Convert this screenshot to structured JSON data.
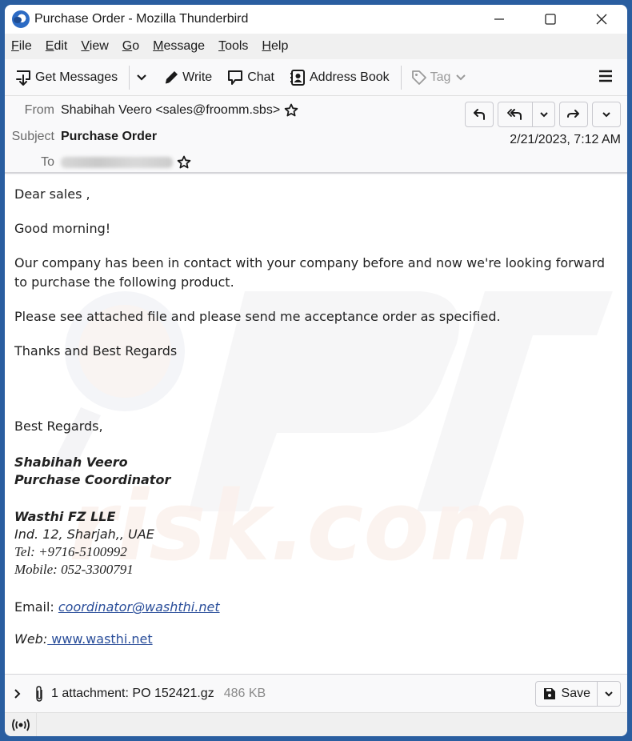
{
  "window": {
    "title": "Purchase Order - Mozilla Thunderbird",
    "controls": {
      "minimize": "minimize-icon",
      "maximize": "maximize-icon",
      "close": "close-icon"
    }
  },
  "menubar": {
    "items": [
      {
        "label": "File",
        "accel": "F",
        "rest": "ile"
      },
      {
        "label": "Edit",
        "accel": "E",
        "rest": "dit"
      },
      {
        "label": "View",
        "accel": "V",
        "rest": "iew"
      },
      {
        "label": "Go",
        "accel": "G",
        "rest": "o"
      },
      {
        "label": "Message",
        "accel": "M",
        "rest": "essage"
      },
      {
        "label": "Tools",
        "accel": "T",
        "rest": "ools"
      },
      {
        "label": "Help",
        "accel": "H",
        "rest": "elp"
      }
    ]
  },
  "toolbar": {
    "get_messages": "Get Messages",
    "write": "Write",
    "chat": "Chat",
    "address_book": "Address Book",
    "tag": "Tag"
  },
  "header": {
    "from_label": "From",
    "from_value": "Shabihah Veero <sales@froomm.sbs>",
    "subject_label": "Subject",
    "subject_value": "Purchase Order",
    "to_label": "To",
    "date": "2/21/2023, 7:12 AM"
  },
  "message": {
    "greeting": "Dear sales ,",
    "line1": "Good morning!",
    "line2": "Our company has been in contact with your company before and now we're looking forward to purchase the following product.",
    "line3": "Please see attached file and please send me acceptance order as specified.",
    "line4": "Thanks and Best Regards",
    "closing": "Best Regards,",
    "sig_name": "Shabihah Veero",
    "sig_title": "Purchase Coordinator",
    "company": "Wasthi FZ LLE",
    "address": "Ind. 12, Sharjah,, UAE",
    "tel": "Tel: +9716-5100992",
    "mobile": "Mobile: 052-3300791",
    "email_label": "Email: ",
    "email_link": " coordinator@washthi.net",
    "web_label": "Web:",
    "web_link": " www.wasthi.net"
  },
  "attachment": {
    "label": "1 attachment: PO 152421.gz",
    "size": "486 KB",
    "save": "Save"
  },
  "watermark": "pcrisk.com"
}
